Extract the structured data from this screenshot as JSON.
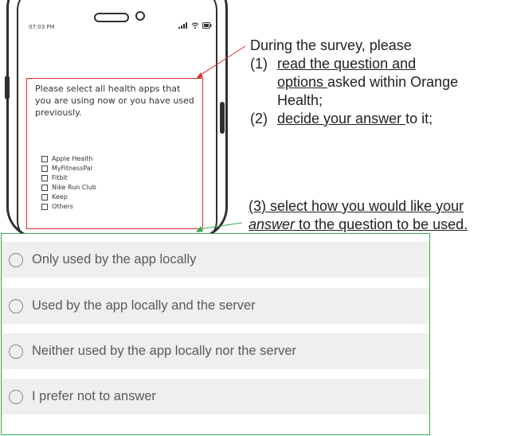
{
  "phone": {
    "status_time": "07:03 PM",
    "status_icons": "..ıl ᯤ ▭",
    "question": "Please select all health apps that you are using now or you have used previously.",
    "options": [
      "Apple Health",
      "MyFitnessPal",
      "Fitbit",
      "Nike Run Club",
      "Keep",
      "Others"
    ]
  },
  "instructions": {
    "intro": "During the survey, please",
    "step1_num": "(1)",
    "step1_a": "read the question and",
    "step1_b": "options ",
    "step1_c": "asked within Orange",
    "step1_d": "Health;",
    "step2_num": "(2)",
    "step2_a": "decide your answer ",
    "step2_b": "to it;",
    "step3_a": "(3) select how you would like your",
    "step3_b": "answer",
    "step3_c": " to the question to be used."
  },
  "answers": [
    {
      "label": "Only used by the app locally"
    },
    {
      "label": "Used by the app locally and the server"
    },
    {
      "label": "Neither used by the app locally nor the server"
    },
    {
      "label": "I prefer not to answer"
    }
  ],
  "colors": {
    "phone_highlight": "#d42f2f",
    "answer_highlight": "#39a94f",
    "row_background": "#efefef"
  },
  "icons": {
    "radio": "radio-empty-icon",
    "checkbox": "checkbox-empty-icon",
    "signal": "signal-icon",
    "wifi": "wifi-icon",
    "battery": "battery-icon"
  }
}
